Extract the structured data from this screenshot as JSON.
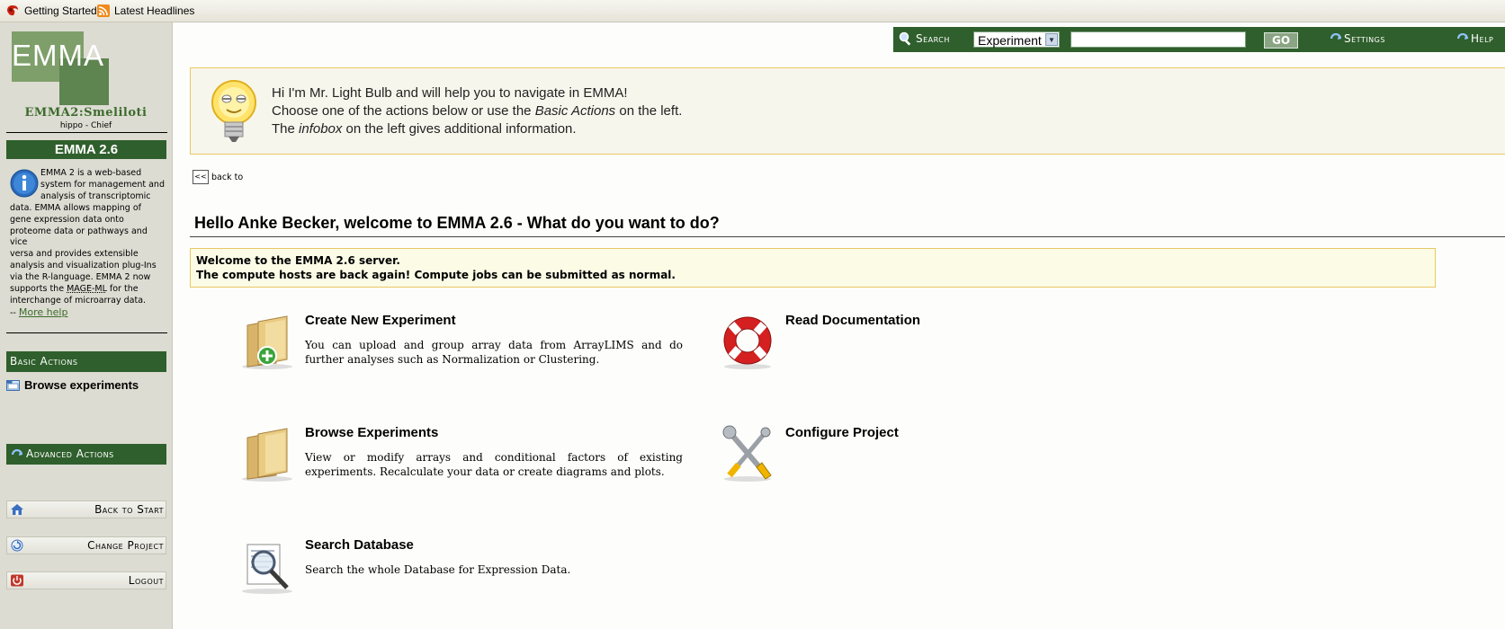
{
  "browser_toolbar": {
    "bookmarks": [
      {
        "label": "Getting Started",
        "icon": "firefox-icon"
      },
      {
        "label": "Latest Headlines",
        "icon": "rss-feed-icon"
      }
    ]
  },
  "brand": {
    "logo_text": "EMMA",
    "project_name": "EMMA2:Smeliloti",
    "user_role": "hippo - Chief",
    "version_label": "EMMA 2.6"
  },
  "infobox": {
    "lines_indented": [
      "EMMA 2 is a web-based",
      "system for management and",
      "analysis of transcriptomic"
    ],
    "lines": [
      "data. EMMA allows mapping of",
      "gene expression data onto",
      "proteome data or pathways and vice",
      "versa and provides extensible",
      "analysis and visualization plug-Ins",
      "via the R-language. EMMA 2 now"
    ],
    "line_mage_pre": "supports the ",
    "line_mage_link": "MAGE-ML",
    "line_mage_post": " for the",
    "line_last": "interchange of microarray data.",
    "more_prefix": "-- ",
    "more_help": "More help"
  },
  "sidebar": {
    "basic_actions_label": "Basic Actions",
    "browse_experiments": "Browse experiments",
    "advanced_actions_label": "Advanced Actions",
    "back_to_start": "Back to Start",
    "change_project": "Change Project",
    "logout": "Logout"
  },
  "topbar": {
    "search_label": "Search",
    "search_scope": "Experiment",
    "search_value": "",
    "go_label": "GO",
    "settings_label": "Settings",
    "help_label": "Help"
  },
  "lightbulb": {
    "line1": "Hi I'm Mr. Light Bulb and will help you to navigate in EMMA!",
    "line2_pre": "Choose one of the actions below or use the ",
    "line2_em": "Basic Actions",
    "line2_post": " on the left.",
    "line3_pre": "The ",
    "line3_em": "infobox",
    "line3_post": " on the left gives additional information."
  },
  "nav": {
    "back_button": "<<",
    "back_label": "back to"
  },
  "main": {
    "welcome_title": "Hello Anke Becker, welcome to EMMA 2.6 - What do you want to do?",
    "notice_line1": "Welcome to the EMMA 2.6 server.",
    "notice_line2": "The compute hosts are back again! Compute jobs can be submitted as normal.",
    "actions": [
      {
        "title": "Create New Experiment",
        "description": "You can upload and group array data from ArrayLIMS and do further analyses such as Normalization or Clustering.",
        "icon": "folder-add-icon"
      },
      {
        "title": "Read Documentation",
        "description": "",
        "icon": "lifebuoy-icon"
      },
      {
        "title": "Browse Experiments",
        "description": "View or modify arrays and conditional factors of existing experiments. Recalculate your data or create diagrams and plots.",
        "icon": "folder-icon"
      },
      {
        "title": "Configure Project",
        "description": "",
        "icon": "tools-icon"
      },
      {
        "title": "Search Database",
        "description": "Search the whole Database for Expression Data.",
        "icon": "magnifier-document-icon"
      }
    ]
  },
  "colors": {
    "brand_green": "#2f5f2c",
    "sidebar_bg": "#dcdcd2",
    "notice_border": "#e8c862"
  }
}
